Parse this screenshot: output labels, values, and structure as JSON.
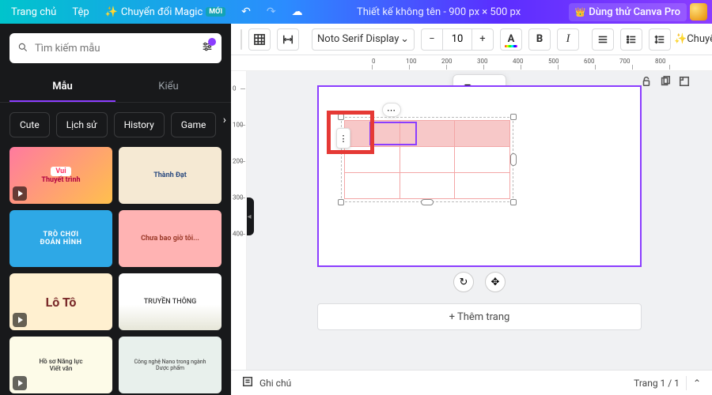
{
  "topbar": {
    "home": "Trang chủ",
    "file": "Tệp",
    "magic": "Chuyển đổi Magic",
    "new_badge": "MỚI",
    "doc_title": "Thiết kế không tên - 900 px × 500 px",
    "try_pro": "Dùng thử Canva Pro"
  },
  "sidebar": {
    "search_placeholder": "Tìm kiếm mẫu",
    "tab_templates": "Mẫu",
    "tab_styles": "Kiểu",
    "chips": [
      "Cute",
      "Lịch sử",
      "History",
      "Game"
    ],
    "templates": {
      "t1a": "Vui",
      "t1b": "Thuyết trình",
      "t2": "Thành Đạt",
      "t3a": "TRÒ CHƠI",
      "t3b": "ĐOÁN HÌNH",
      "t4": "Chưa bao giờ tôi...",
      "t5": "Lô Tô",
      "t6": "TRUYỀN THÔNG",
      "t7a": "Hồ sơ Năng lực",
      "t7b": "Viết văn",
      "t8a": "Công nghệ Nano trong ngành",
      "t8b": "Dược phẩm"
    }
  },
  "toolbar": {
    "font": "Noto Serif Display",
    "font_size": "10",
    "bold": "B",
    "italic": "I",
    "txtcolor": "A",
    "magic_lbl": "Chuyể"
  },
  "ruler": {
    "h": {
      "0": "0",
      "100": "100",
      "200": "200",
      "300": "300",
      "400": "400",
      "500": "500",
      "600": "600",
      "700": "700",
      "800": "800"
    },
    "v": {
      "0": "0",
      "100": "100",
      "200": "200",
      "300": "300",
      "400": "400"
    }
  },
  "canvas": {
    "add_page": "+ Thêm trang"
  },
  "footer": {
    "notes": "Ghi chú",
    "page_counter": "Trang 1 / 1"
  }
}
